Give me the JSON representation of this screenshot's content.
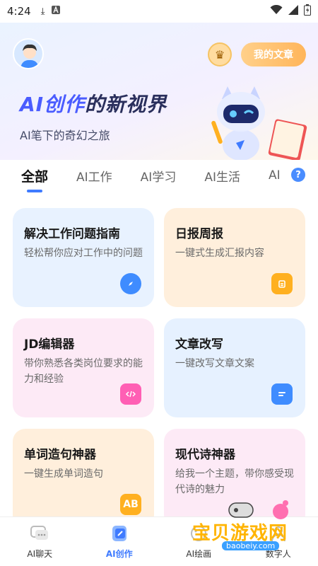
{
  "status_bar": {
    "time": "4:24"
  },
  "header": {
    "my_articles_label": "我的文章",
    "title_ai": "AI创作",
    "title_rest": "的新视界",
    "subtitle": "AI笔下的奇幻之旅"
  },
  "tabs": [
    {
      "label": "全部",
      "active": true
    },
    {
      "label": "AI工作",
      "active": false
    },
    {
      "label": "AI学习",
      "active": false
    },
    {
      "label": "AI生活",
      "active": false
    },
    {
      "label": "AI",
      "active": false
    }
  ],
  "cards": [
    {
      "title": "解决工作问题指南",
      "desc": "轻松帮你应对工作中的问题",
      "icon": "compass-icon",
      "color": "#3f8cff"
    },
    {
      "title": "日报周报",
      "desc": "一键式生成汇报内容",
      "icon": "calendar-icon",
      "color": "#ffb020"
    },
    {
      "title": "JD编辑器",
      "desc": "带你熟悉各类岗位要求的能力和经验",
      "icon": "code-icon",
      "color": "#ff5fb4"
    },
    {
      "title": "文章改写",
      "desc": "一键改写文章文案",
      "icon": "document-icon",
      "color": "#3f8cff"
    },
    {
      "title": "单词造句神器",
      "desc": "一键生成单词造句",
      "icon": "ab-icon",
      "color": "#ffb020",
      "icon_text": "AB"
    },
    {
      "title": "现代诗神器",
      "desc": "给我一个主题，带你感受现代诗的魅力",
      "icon": "",
      "color": "#ff5fb4"
    }
  ],
  "bottom_nav": [
    {
      "label": "AI聊天",
      "icon": "chat-icon",
      "active": false
    },
    {
      "label": "AI创作",
      "icon": "create-icon",
      "active": true
    },
    {
      "label": "AI绘画",
      "icon": "paint-icon",
      "active": false
    },
    {
      "label": "数字人",
      "icon": "digital-human-icon",
      "active": false
    }
  ],
  "watermark": {
    "text": "宝贝游戏网",
    "url": "baobeiy.com"
  },
  "colors": {
    "accent": "#3f7bff",
    "button_orange": "#ffb55a"
  }
}
